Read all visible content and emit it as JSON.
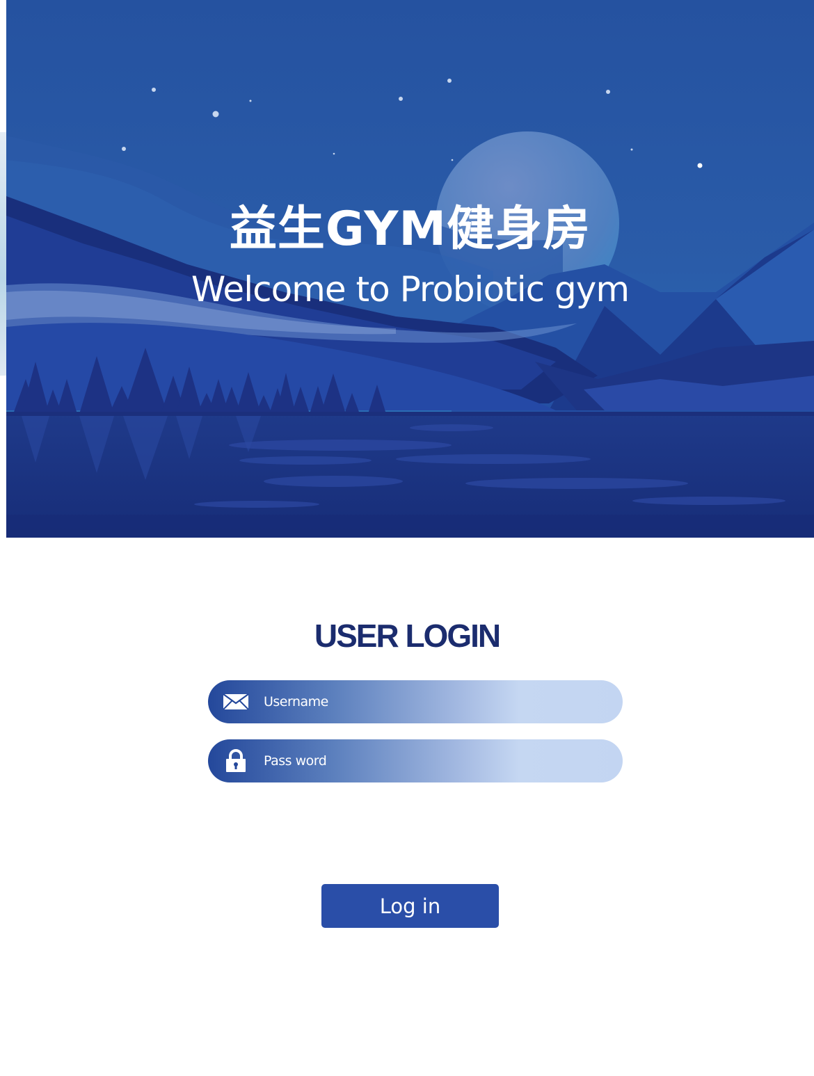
{
  "header": {
    "title_cn": "益生GYM健身房",
    "subtitle_en": "Welcome to Probiotic gym"
  },
  "login": {
    "heading": "USER LOGIN",
    "username": {
      "value": "",
      "placeholder": "Username",
      "icon": "envelope-icon"
    },
    "password": {
      "value": "",
      "placeholder": "Pass word",
      "icon": "lock-icon"
    },
    "submit_label": "Log in"
  },
  "colors": {
    "sky": "#2a53a1",
    "night_blue": "#1b2c6e",
    "button": "#2a4ea8",
    "field_light": "#c5d7f2"
  }
}
